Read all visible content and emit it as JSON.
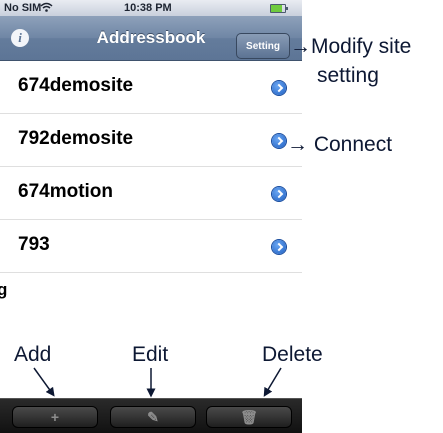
{
  "status_bar": {
    "carrier": "No SIM",
    "time": "10:38 PM",
    "wifi_icon": "wifi-icon",
    "battery_icon": "battery-icon"
  },
  "nav_bar": {
    "title": "Addressbook",
    "info_icon": "info-icon",
    "info_glyph": "i",
    "setting_label": "Setting"
  },
  "sites": [
    {
      "label": "674demosite"
    },
    {
      "label": "792demosite"
    },
    {
      "label": "674motion"
    },
    {
      "label": "793"
    }
  ],
  "clipped_text": "g",
  "annotations": {
    "modify_line1": "→Modify site",
    "modify_line2": "setting",
    "connect": "→ Connect",
    "add": "Add",
    "edit": "Edit",
    "delete": "Delete"
  },
  "toolbar": {
    "add_glyph": "+",
    "edit_glyph": "✎",
    "delete_glyph": "🗑"
  },
  "colors": {
    "nav_bar": "#6f86a5",
    "disclosure": "#1e5fc2",
    "toolbar": "#1a1a1a"
  }
}
